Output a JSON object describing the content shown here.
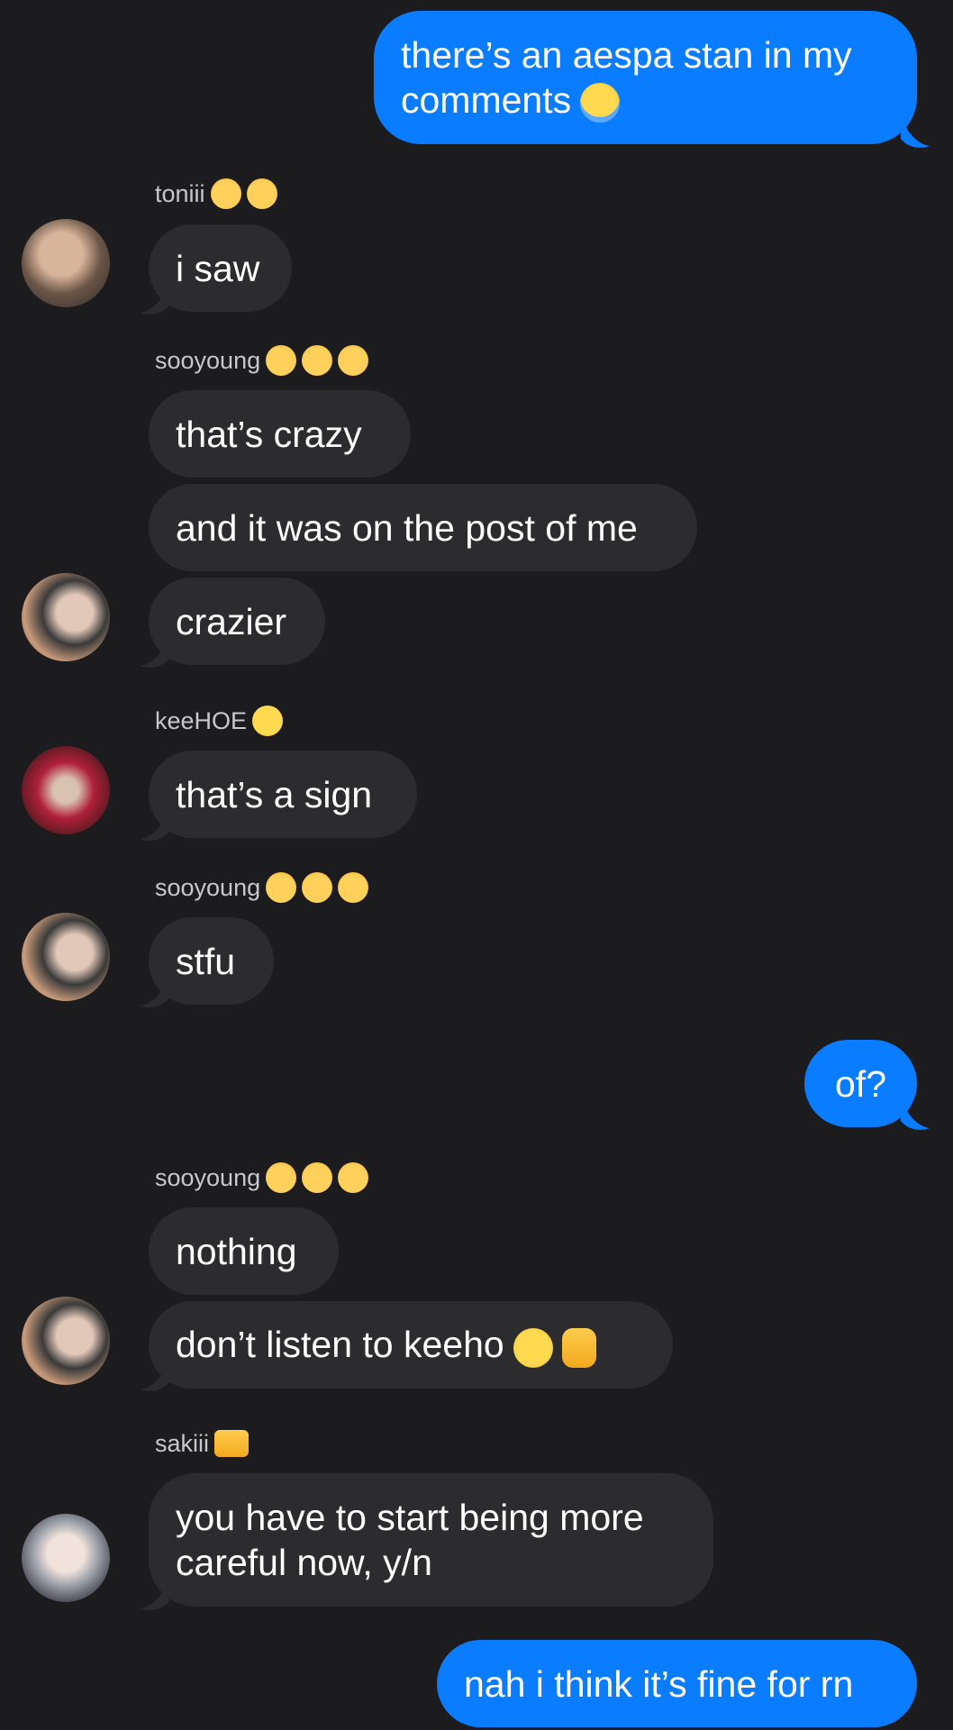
{
  "messages": [
    {
      "text": "there’s an aespa stan in my comments",
      "emoji": "loudly-crying-face"
    },
    {
      "sender": "toniii",
      "sender_emojis": [
        "kissing-cat",
        "kissing-cat"
      ],
      "text": "i saw"
    },
    {
      "sender": "sooyoung",
      "sender_emojis": [
        "heart-eyes-cat",
        "heart-eyes-cat",
        "heart-eyes-cat"
      ],
      "texts": [
        "that’s crazy",
        "and it was on the post of me",
        "crazier"
      ]
    },
    {
      "sender": "keeHOE",
      "sender_emojis": [
        "worried-face"
      ],
      "text": "that’s a sign"
    },
    {
      "sender": "sooyoung",
      "sender_emojis": [
        "heart-eyes-cat",
        "heart-eyes-cat",
        "heart-eyes-cat"
      ],
      "text": "stfu"
    },
    {
      "text": "of?"
    },
    {
      "sender": "sooyoung",
      "sender_emojis": [
        "heart-eyes-cat",
        "heart-eyes-cat",
        "heart-eyes-cat"
      ],
      "texts": [
        "nothing",
        "don’t listen to keeho"
      ],
      "trailing_emojis": [
        "face-with-rolling-eyes",
        "raised-hand"
      ]
    },
    {
      "sender": "sakiii",
      "sender_emojis": [
        "heart-hands"
      ],
      "text": "you have to start being more careful now, y/n"
    },
    {
      "text": "nah i think it’s fine for rn"
    }
  ],
  "colors": {
    "background": "#1c1c1e",
    "incoming_bubble": "#2c2c2e",
    "outgoing_bubble": "#0a7cff",
    "sender_name": "#c7c7cc"
  }
}
